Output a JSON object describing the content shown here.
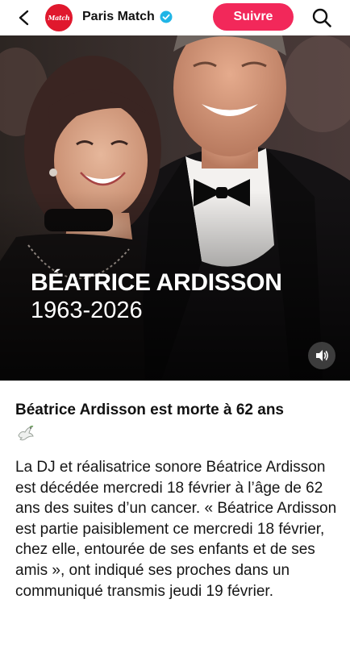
{
  "header": {
    "account_name": "Paris Match",
    "logo_text": "Match",
    "follow_label": "Suivre",
    "icons": [
      "back-arrow-icon",
      "verified-badge-icon",
      "search-icon"
    ],
    "accent_color": "#f2285a",
    "verified_color": "#20b5e6"
  },
  "media": {
    "title": "BÉATRICE ARDISSON",
    "years": "1963-2026",
    "sound_icon": "speaker-icon"
  },
  "article": {
    "headline": "Béatrice Ardisson est morte à 62 ans",
    "emoji": "dove-icon",
    "body": "La DJ et réalisatrice sonore Béatrice Ardisson est décédée mercredi 18 février à l’âge de 62 ans des suites d’un cancer. « Béatrice Ardisson est partie paisiblement ce mercredi 18 février, chez elle, entourée de ses enfants et de ses amis », ont indiqué ses proches dans un communiqué transmis jeudi 19 février."
  }
}
